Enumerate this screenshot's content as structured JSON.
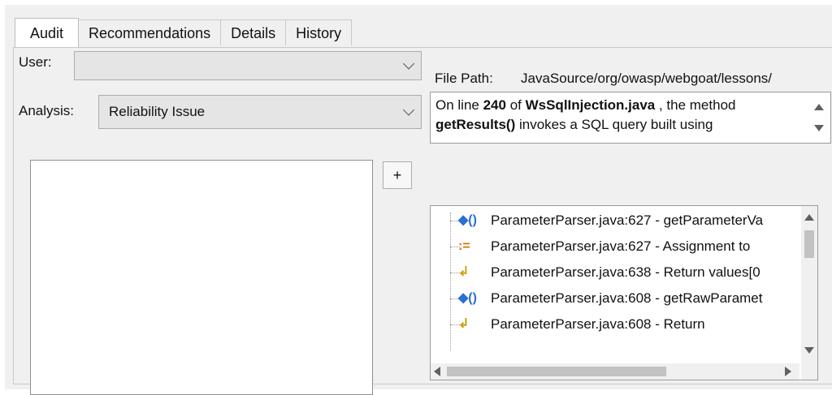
{
  "tabs": [
    {
      "label": "Audit",
      "active": true
    },
    {
      "label": "Recommendations",
      "active": false
    },
    {
      "label": "Details",
      "active": false
    },
    {
      "label": "History",
      "active": false
    }
  ],
  "user": {
    "label": "User:",
    "value": ""
  },
  "analysis": {
    "label": "Analysis:",
    "value": "Reliability Issue"
  },
  "file_path": {
    "label": "File Path:",
    "value": "JavaSource/org/owasp/webgoat/lessons/"
  },
  "description": {
    "seg1": "On line ",
    "line": "240",
    "seg2": " of ",
    "file": "WsSqlInjection.java",
    "seg3": " , the method",
    "method": "getResults()",
    "seg4": "  invokes a SQL query built using"
  },
  "add_button": {
    "label": "+"
  },
  "trace": [
    {
      "icon": "◆()",
      "icon_name": "method-call-icon",
      "color": "#2a6fd6",
      "text": "ParameterParser.java:627 - getParameterVa"
    },
    {
      "icon": ":=",
      "icon_name": "assignment-icon",
      "color": "#d07a00",
      "text": "ParameterParser.java:627 - Assignment to"
    },
    {
      "icon": "↲",
      "icon_name": "return-icon",
      "color": "#c9a100",
      "text": "ParameterParser.java:638 - Return values[0"
    },
    {
      "icon": "◆()",
      "icon_name": "method-call-icon",
      "color": "#2a6fd6",
      "text": "ParameterParser.java:608 - getRawParamet"
    },
    {
      "icon": "↲",
      "icon_name": "return-icon",
      "color": "#c9a100",
      "text": "ParameterParser.java:608 - Return"
    }
  ]
}
